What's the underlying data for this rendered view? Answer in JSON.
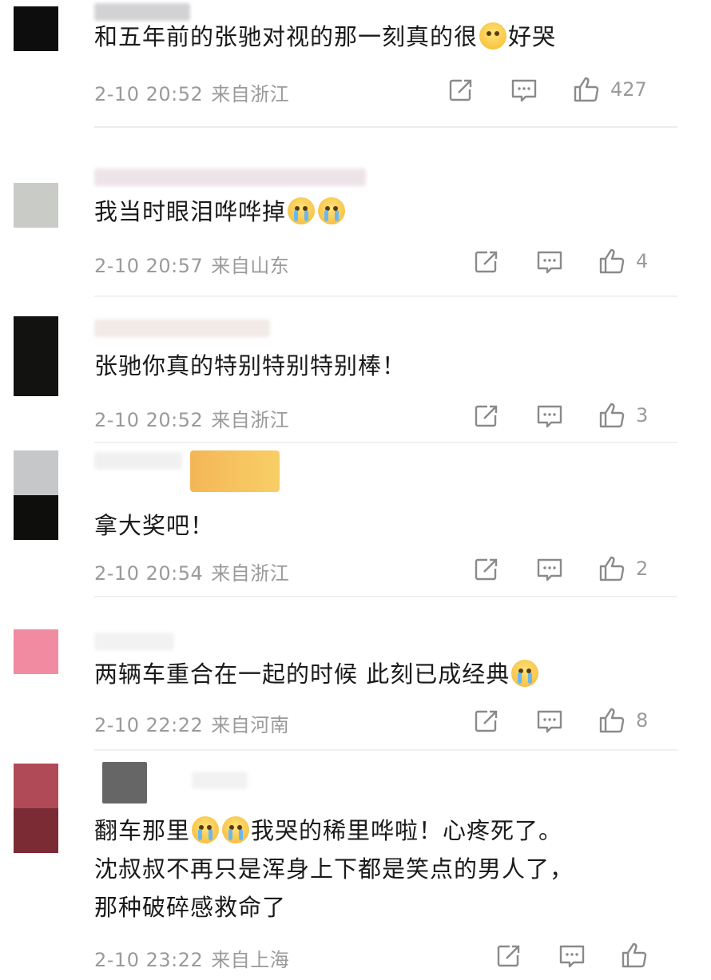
{
  "comments": [
    {
      "text": "和五年前的张驰对视的那一刻真的很",
      "text_tail": "好哭",
      "date": "2-10 20:52",
      "location": "来自浙江",
      "likes": "427",
      "avatar_colors": [
        "#0d0d0d",
        "#0d0d0d"
      ]
    },
    {
      "text": "我当时眼泪哗哗掉",
      "date": "2-10 20:57",
      "location": "来自山东",
      "likes": "4",
      "avatar_colors": [
        "#c9cbc6",
        "#c9cbc6"
      ]
    },
    {
      "text": "张驰你真的特别特别特别棒！",
      "date": "2-10 20:52",
      "location": "来自浙江",
      "likes": "3",
      "avatar_colors": [
        "#121210",
        "#121210"
      ]
    },
    {
      "text": "拿大奖吧！",
      "date": "2-10 20:54",
      "location": "来自浙江",
      "likes": "2",
      "avatar_colors": [
        "#c6c7c9",
        "#0e0e0c"
      ]
    },
    {
      "text": "两辆车重合在一起的时候 此刻已成经典",
      "date": "2-10 22:22",
      "location": "来自河南",
      "likes": "8",
      "avatar_colors": [
        "#f08ba2",
        "#f08ba2"
      ]
    },
    {
      "line1_a": "翻车那里",
      "line1_b": "我哭的稀里哗啦！心疼死了。",
      "line2": "沈叔叔不再只是浑身上下都是笑点的男人了，",
      "line3": "那种破碎感救命了",
      "date": "2-10 23:22",
      "location": "来自上海",
      "likes": "",
      "avatar_colors": [
        "#b14a57",
        "#7a2b34"
      ]
    }
  ],
  "icons": {
    "share": "share-icon",
    "comment": "comment-icon",
    "like": "thumbs-up-icon"
  }
}
